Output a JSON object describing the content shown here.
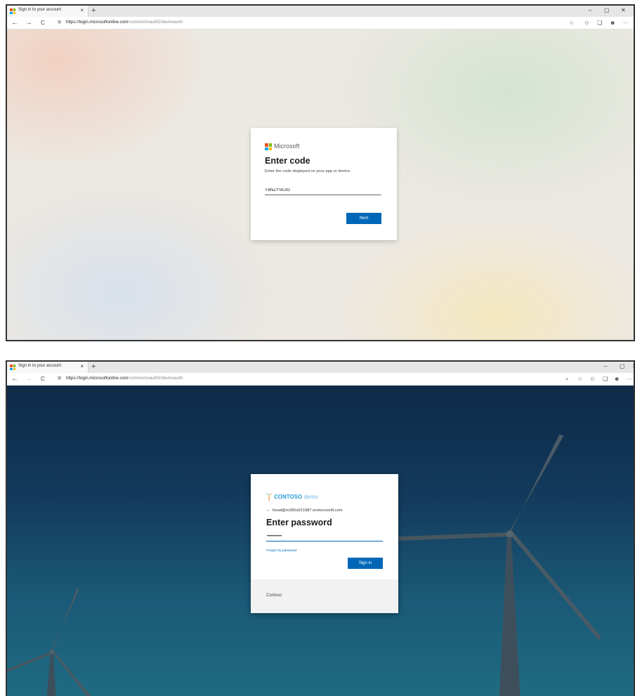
{
  "top": {
    "tab": {
      "title": "Sign in to your account",
      "close": "×",
      "new_tab": "+"
    },
    "window": {
      "minimize": "–",
      "maximize": "▢",
      "close": "✕"
    },
    "nav": {
      "back": "←",
      "forward": "→",
      "refresh": "C",
      "lock": "⛨"
    },
    "url": {
      "host": "https://login.microsoftonline.com",
      "path": "/common/oauth2/deviceauth"
    },
    "toolbar": [
      "☆",
      "✩",
      "❏",
      "☻",
      "···"
    ],
    "card": {
      "brand": "Microsoft",
      "title": "Enter code",
      "description": "Enter the code displayed on your app or device.",
      "code_value": "F8NZYVE3G",
      "button": "Next"
    }
  },
  "bottom": {
    "tab": {
      "title": "Sign in to your account",
      "close": "×",
      "new_tab": "+"
    },
    "window": {
      "minimize": "–",
      "maximize": "▢",
      "close": "✕"
    },
    "nav": {
      "back": "←",
      "forward": "→",
      "refresh": "C",
      "lock": "⛨"
    },
    "url": {
      "host": "https://login.microsoftonline.com",
      "path": "/common/oauth2/deviceauth"
    },
    "toolbar": [
      "⌕",
      "☆",
      "✩",
      "❏",
      "☻",
      "···"
    ],
    "card": {
      "brand_bold": "CONTOSO",
      "brand_light": " demo",
      "back": "←",
      "email": "hood@m365x021987.onmicrosoft.com",
      "title": "Enter password",
      "password_value": "••••••••••",
      "forgot": "Forgot my password",
      "button": "Sign in",
      "footer": "Contoso"
    }
  }
}
